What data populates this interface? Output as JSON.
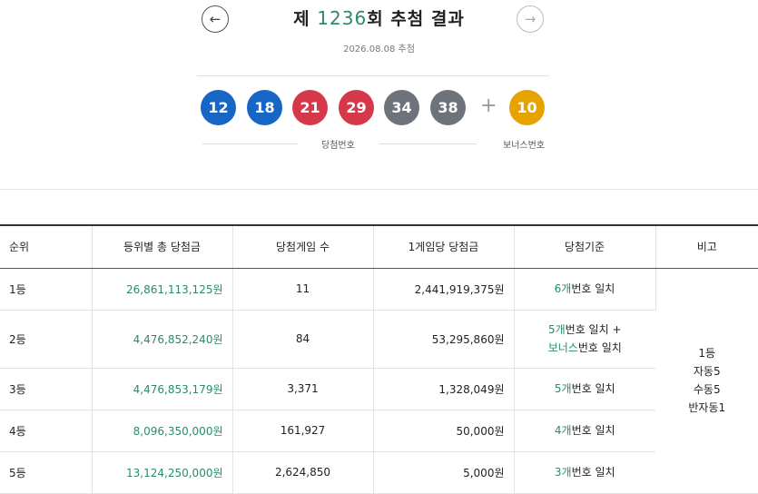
{
  "header": {
    "title_prefix": "제 ",
    "round_number": "1236",
    "title_suffix": "회 추첨 결과",
    "draw_date": "2026.08.08 추첨",
    "prev_icon": "arrow-left-icon",
    "next_icon": "arrow-right-icon"
  },
  "numbers": {
    "winning": [
      {
        "value": "12",
        "color": "#1766c6"
      },
      {
        "value": "18",
        "color": "#1766c6"
      },
      {
        "value": "21",
        "color": "#d43849"
      },
      {
        "value": "29",
        "color": "#d43849"
      },
      {
        "value": "34",
        "color": "#6d727b"
      },
      {
        "value": "38",
        "color": "#6d727b"
      }
    ],
    "plus": "+",
    "bonus": {
      "value": "10",
      "color": "#e6a300"
    },
    "winning_label": "당첨번호",
    "bonus_label": "보너스번호"
  },
  "table": {
    "headers": [
      "순위",
      "등위별 총 당첨금",
      "당첨게임 수",
      "1게임당 당첨금",
      "당첨기준",
      "비고"
    ],
    "rows": [
      {
        "rank": "1등",
        "total": "26,861,113,125원",
        "games": "11",
        "per_game": "2,441,919,375원",
        "crit_hl": "6개",
        "crit_rest": "번호 일치"
      },
      {
        "rank": "2등",
        "total": "4,476,852,240원",
        "games": "84",
        "per_game": "53,295,860원",
        "crit_hl": "5개",
        "crit_rest": "번호 일치 +",
        "crit_hl2": "보너스",
        "crit_rest2": "번호 일치"
      },
      {
        "rank": "3등",
        "total": "4,476,853,179원",
        "games": "3,371",
        "per_game": "1,328,049원",
        "crit_hl": "5개",
        "crit_rest": "번호 일치"
      },
      {
        "rank": "4등",
        "total": "8,096,350,000원",
        "games": "161,927",
        "per_game": "50,000원",
        "crit_hl": "4개",
        "crit_rest": "번호 일치"
      },
      {
        "rank": "5등",
        "total": "13,124,250,000원",
        "games": "2,624,850",
        "per_game": "5,000원",
        "crit_hl": "3개",
        "crit_rest": "번호 일치"
      }
    ],
    "note": {
      "line1": "1등",
      "line2": "자동5",
      "line3": "수동5",
      "line4": "반자동1"
    }
  }
}
